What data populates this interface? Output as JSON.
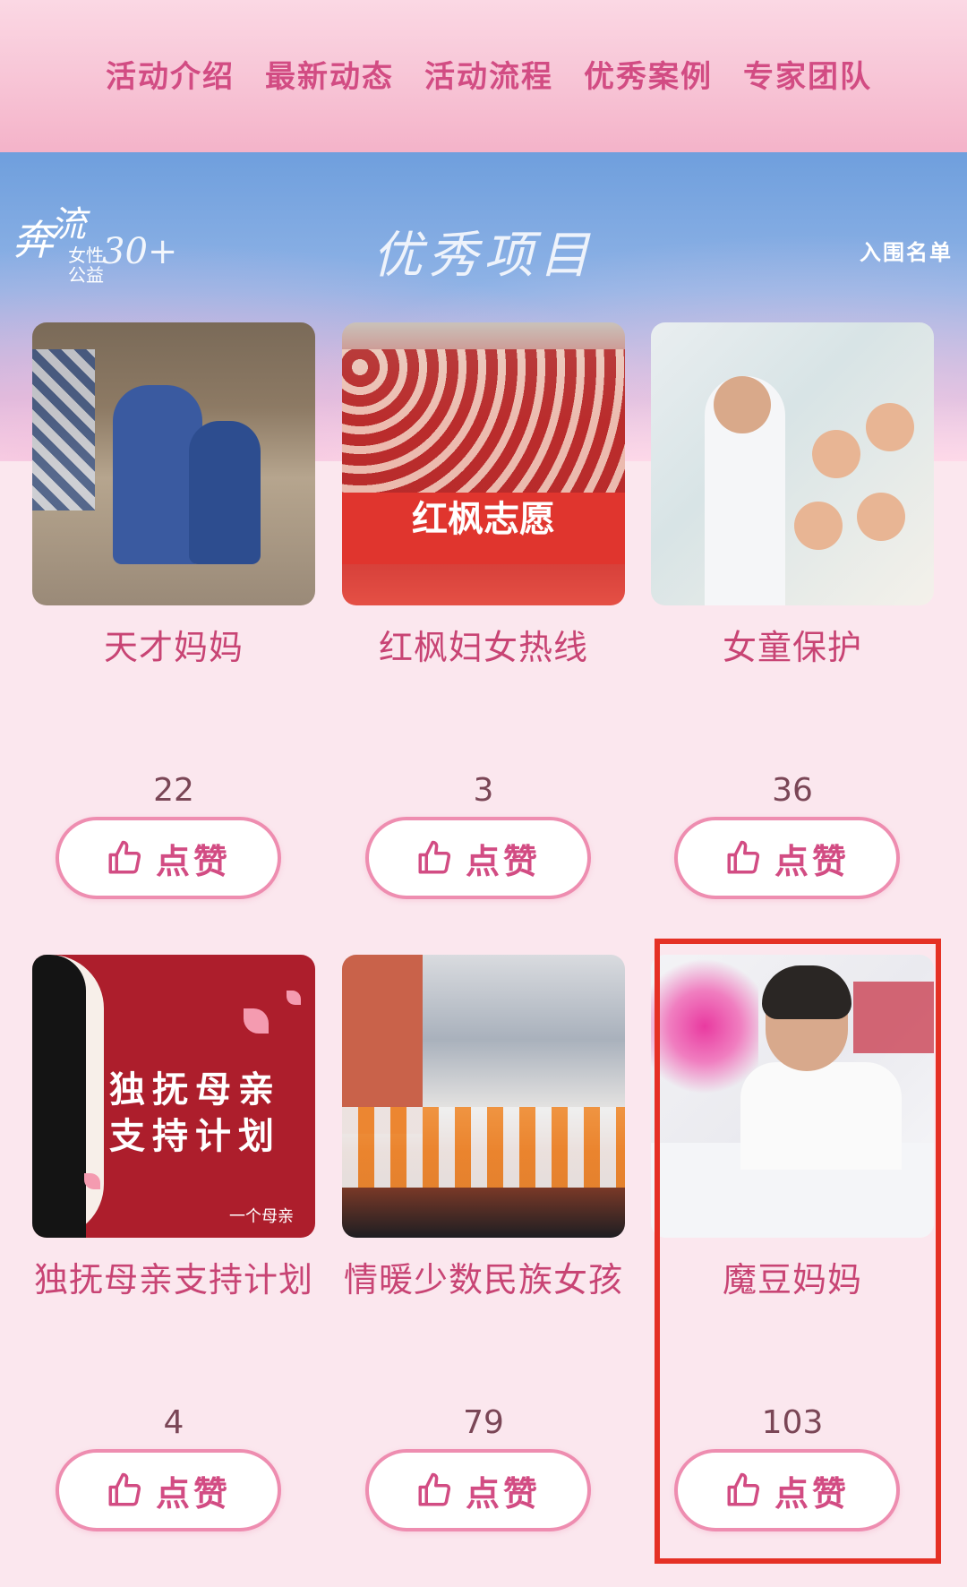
{
  "nav": {
    "items": [
      "活动介绍",
      "最新动态",
      "活动流程",
      "优秀案例",
      "专家团队"
    ]
  },
  "banner": {
    "logo": {
      "line1": "奔",
      "line2": "流",
      "line3": "女性\n公益",
      "line4": "30+"
    },
    "title": "优秀项目",
    "shortlist_link": "入围名单"
  },
  "projects": [
    {
      "name": "天才妈妈",
      "likes": "22",
      "like_label": "点赞",
      "image": "mother-and-daughter-photo"
    },
    {
      "name": "红枫妇女热线",
      "likes": "3",
      "like_label": "点赞",
      "image": "red-maple-volunteers-photo",
      "image_text": "红枫志愿"
    },
    {
      "name": "女童保护",
      "likes": "36",
      "like_label": "点赞",
      "image": "teacher-with-children-photo"
    },
    {
      "name": "独抚母亲支持计划",
      "likes": "4",
      "like_label": "点赞",
      "image": "single-mother-poster",
      "image_text_1": "独抚母亲",
      "image_text_2": "支持计划",
      "image_brand": "一个母亲"
    },
    {
      "name": "情暖少数民族女孩",
      "likes": "79",
      "like_label": "点赞",
      "image": "ethnic-girls-dancing-photo"
    },
    {
      "name": "魔豆妈妈",
      "likes": "103",
      "like_label": "点赞",
      "image": "woman-drinking-photo",
      "highlighted": true
    }
  ],
  "colors": {
    "accent": "#d24c83",
    "button_border": "#ee8db0",
    "highlight": "#e53125"
  }
}
